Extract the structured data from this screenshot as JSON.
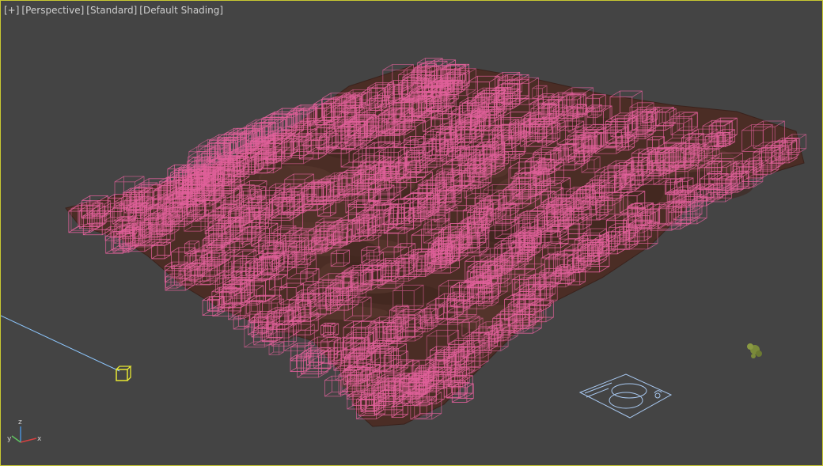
{
  "viewport": {
    "labels": {
      "menu": "[+]",
      "view": "[Perspective]",
      "camera_mode": "[Standard]",
      "shading": "[Default Shading]"
    },
    "axes": {
      "x": "x",
      "y": "y",
      "z": "z"
    },
    "colors": {
      "background": "#444444",
      "active_border": "#c8c832",
      "terrain": "#4a2c24",
      "scatter_proxies": "#e0609a",
      "helper": "#8ec8ff",
      "light": "#e8e832",
      "foliage": "#7a8a3a"
    }
  }
}
